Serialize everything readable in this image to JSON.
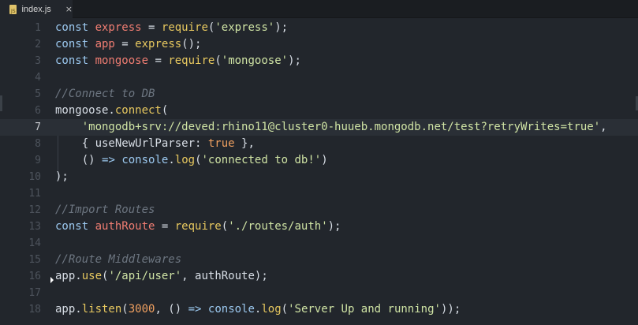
{
  "tab": {
    "icon": "js-file-icon",
    "icon_text": "JS",
    "label": "index.js",
    "close": "×"
  },
  "lines": [
    {
      "n": "1",
      "tokens": [
        [
          "kw",
          "const "
        ],
        [
          "var",
          "express"
        ],
        [
          "pun",
          " = "
        ],
        [
          "fn",
          "require"
        ],
        [
          "pun",
          "("
        ],
        [
          "str",
          "'express'"
        ],
        [
          "pun",
          ");"
        ]
      ]
    },
    {
      "n": "2",
      "tokens": [
        [
          "kw",
          "const "
        ],
        [
          "var",
          "app"
        ],
        [
          "pun",
          " = "
        ],
        [
          "fn",
          "express"
        ],
        [
          "pun",
          "();"
        ]
      ]
    },
    {
      "n": "3",
      "tokens": [
        [
          "kw",
          "const "
        ],
        [
          "var",
          "mongoose"
        ],
        [
          "pun",
          " = "
        ],
        [
          "fn",
          "require"
        ],
        [
          "pun",
          "("
        ],
        [
          "str",
          "'mongoose'"
        ],
        [
          "pun",
          ");"
        ]
      ]
    },
    {
      "n": "4",
      "tokens": []
    },
    {
      "n": "5",
      "tokens": [
        [
          "cmt",
          "//Connect to DB"
        ]
      ]
    },
    {
      "n": "6",
      "tokens": [
        [
          "pun",
          "mongoose."
        ],
        [
          "fn",
          "connect"
        ],
        [
          "pun",
          "("
        ]
      ]
    },
    {
      "n": "7",
      "active": true,
      "tokens": [
        [
          "pun",
          "    "
        ],
        [
          "str",
          "'mongodb+srv://deved:rhino11@cluster0-huueb.mongodb.net/test?retryWrites=true'"
        ],
        [
          "pun",
          ","
        ]
      ]
    },
    {
      "n": "8",
      "tokens": [
        [
          "pun",
          "    { "
        ],
        [
          "prop",
          "useNewUrlParser"
        ],
        [
          "pun",
          ": "
        ],
        [
          "bool",
          "true"
        ],
        [
          "pun",
          " },"
        ]
      ]
    },
    {
      "n": "9",
      "tokens": [
        [
          "pun",
          "    () "
        ],
        [
          "kw",
          "=>"
        ],
        [
          "pun",
          " "
        ],
        [
          "obj",
          "console"
        ],
        [
          "pun",
          "."
        ],
        [
          "fn",
          "log"
        ],
        [
          "pun",
          "("
        ],
        [
          "str",
          "'connected to db!'"
        ],
        [
          "pun",
          ")"
        ]
      ]
    },
    {
      "n": "10",
      "tokens": [
        [
          "pun",
          ");"
        ]
      ]
    },
    {
      "n": "11",
      "tokens": []
    },
    {
      "n": "12",
      "tokens": [
        [
          "cmt",
          "//Import Routes"
        ]
      ]
    },
    {
      "n": "13",
      "tokens": [
        [
          "kw",
          "const "
        ],
        [
          "var",
          "authRoute"
        ],
        [
          "pun",
          " = "
        ],
        [
          "fn",
          "require"
        ],
        [
          "pun",
          "("
        ],
        [
          "str",
          "'./routes/auth'"
        ],
        [
          "pun",
          ");"
        ]
      ]
    },
    {
      "n": "14",
      "tokens": []
    },
    {
      "n": "15",
      "tokens": [
        [
          "cmt",
          "//Route Middlewares"
        ]
      ]
    },
    {
      "n": "16",
      "tokens": [
        [
          "pun",
          "app."
        ],
        [
          "fn",
          "use"
        ],
        [
          "pun",
          "("
        ],
        [
          "str",
          "'/api/user'"
        ],
        [
          "pun",
          ", authRoute);"
        ]
      ]
    },
    {
      "n": "17",
      "tokens": []
    },
    {
      "n": "18",
      "tokens": [
        [
          "pun",
          "app."
        ],
        [
          "fn",
          "listen"
        ],
        [
          "pun",
          "("
        ],
        [
          "num",
          "3000"
        ],
        [
          "pun",
          ", () "
        ],
        [
          "kw",
          "=>"
        ],
        [
          "pun",
          " "
        ],
        [
          "obj",
          "console"
        ],
        [
          "pun",
          "."
        ],
        [
          "fn",
          "log"
        ],
        [
          "pun",
          "("
        ],
        [
          "str",
          "'Server Up and running'"
        ],
        [
          "pun",
          "));"
        ]
      ]
    }
  ]
}
